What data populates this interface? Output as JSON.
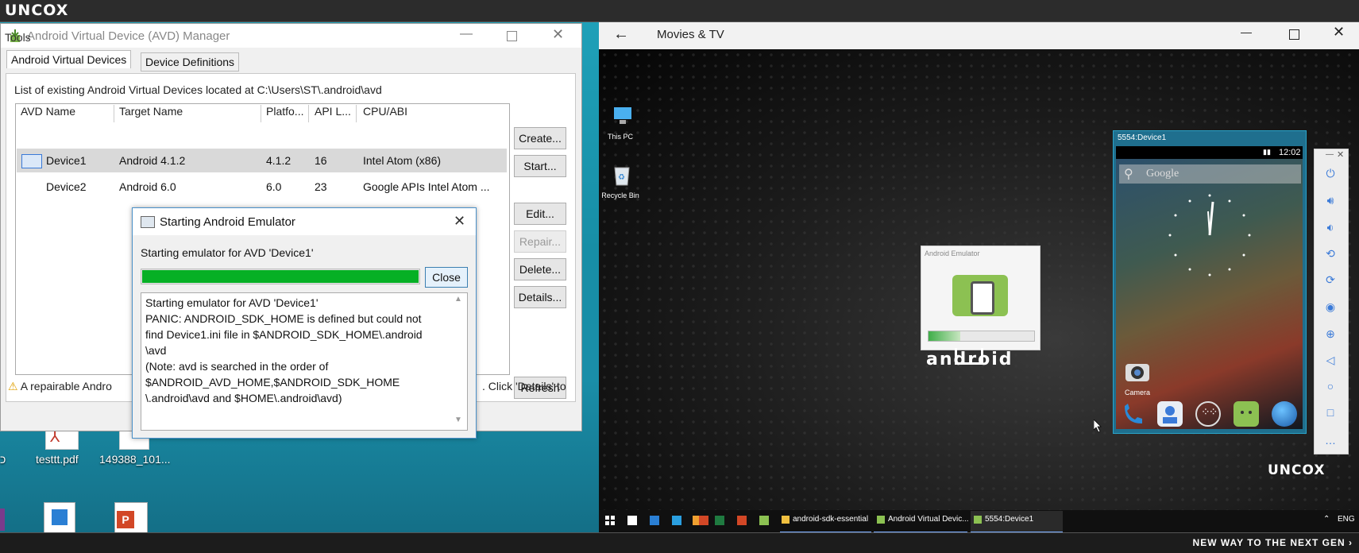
{
  "top_bar": {
    "logo": "UNCOX"
  },
  "bottom_bar": {
    "tagline": "NEW WAY TO THE NEXT GEN ›"
  },
  "avd_manager": {
    "title": "Android Virtual Device (AVD) Manager",
    "menu": "Tools",
    "tabs": [
      "Android Virtual Devices",
      "Device Definitions"
    ],
    "list_caption": "List of existing Android Virtual Devices located at C:\\Users\\ST\\.android\\avd",
    "columns": [
      "AVD Name",
      "Target Name",
      "Platfo...",
      "API L...",
      "CPU/ABI"
    ],
    "rows": [
      {
        "name": "Device1",
        "target": "Android 4.1.2",
        "platform": "4.1.2",
        "api": "16",
        "cpu": "Intel Atom (x86)"
      },
      {
        "name": "Device2",
        "target": "Android 6.0",
        "platform": "6.0",
        "api": "23",
        "cpu": "Google APIs Intel Atom ..."
      }
    ],
    "buttons": {
      "create": "Create...",
      "start": "Start...",
      "edit": "Edit...",
      "repair": "Repair...",
      "delete": "Delete...",
      "details": "Details...",
      "refresh": "Refresh"
    },
    "warning_left": "A repairable Andro",
    "warning_right": ". Click 'Details' to"
  },
  "emulator_dialog": {
    "title": "Starting Android Emulator",
    "message": "Starting emulator for AVD 'Device1'",
    "progress": 1.0,
    "close_label": "Close",
    "log": [
      "Starting emulator for AVD 'Device1'",
      "PANIC: ANDROID_SDK_HOME is defined but could not",
      "find Device1.ini file in $ANDROID_SDK_HOME\\.android",
      "\\avd",
      "(Note: avd is searched in the order of",
      "$ANDROID_AVD_HOME,$ANDROID_SDK_HOME",
      "\\.android\\avd and $HOME\\.android\\avd)"
    ]
  },
  "desktop_left": {
    "icons": [
      "testtt.pdf",
      "149388_101..."
    ]
  },
  "movies_tv": {
    "title": "Movies & TV"
  },
  "desktop_right": {
    "icons": [
      "This PC",
      "Recycle Bin"
    ]
  },
  "emulator_card": {
    "title": "Android Emulator",
    "progress": 0.3
  },
  "android_watermark": "android",
  "device": {
    "title": "5554:Device1",
    "time": "12:02",
    "search": "Google",
    "camera_label": "Camera"
  },
  "taskbar": {
    "items": [
      "android-sdk-essential",
      "Android Virtual Devic...",
      "5554:Device1"
    ],
    "lang": "ENG"
  },
  "watermark": "UNCOX"
}
